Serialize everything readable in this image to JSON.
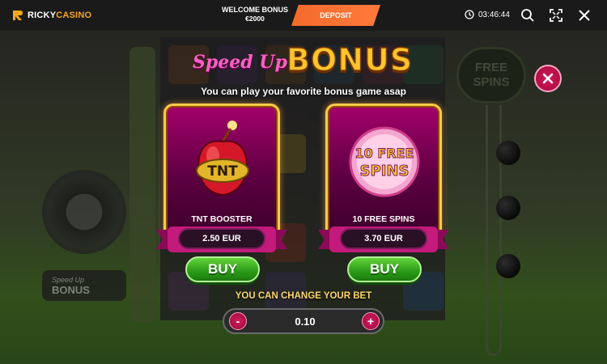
{
  "topbar": {
    "brand_main": "RICKY",
    "brand_accent": "CASINO",
    "welcome_line1": "WELCOME BONUS",
    "welcome_line2": "€2000",
    "deposit_label": "DEPOSIT",
    "clock_time": "03:46:44",
    "icons": [
      "clock-icon",
      "search-icon",
      "fullscreen-icon",
      "close-icon"
    ]
  },
  "background": {
    "left_bonus_small": "Speed Up",
    "left_bonus_large": "BONUS",
    "free_spins_label": "FREE SPINS"
  },
  "popup": {
    "title_script": "Speed Up",
    "title_bold": "BONUS",
    "subtitle": "You can play your favorite bonus game asap",
    "options": [
      {
        "name": "TNT BOOSTER",
        "price": "2.50 EUR",
        "buy_label": "BUY",
        "art_text": "TNT"
      },
      {
        "name": "10 FREE SPINS",
        "price": "3.70 EUR",
        "buy_label": "BUY",
        "art_line1": "10 FREE",
        "art_line2": "SPINS"
      }
    ],
    "bet_label": "YOU CAN CHANGE YOUR BET",
    "bet_value": "0.10",
    "bet_minus": "-",
    "bet_plus": "+"
  },
  "colors": {
    "deposit": "#f36b2b",
    "card_magenta": "#a3006a",
    "gold": "#ffc42e",
    "buy_green": "#2a9a17",
    "close_pink": "#d5195a"
  }
}
